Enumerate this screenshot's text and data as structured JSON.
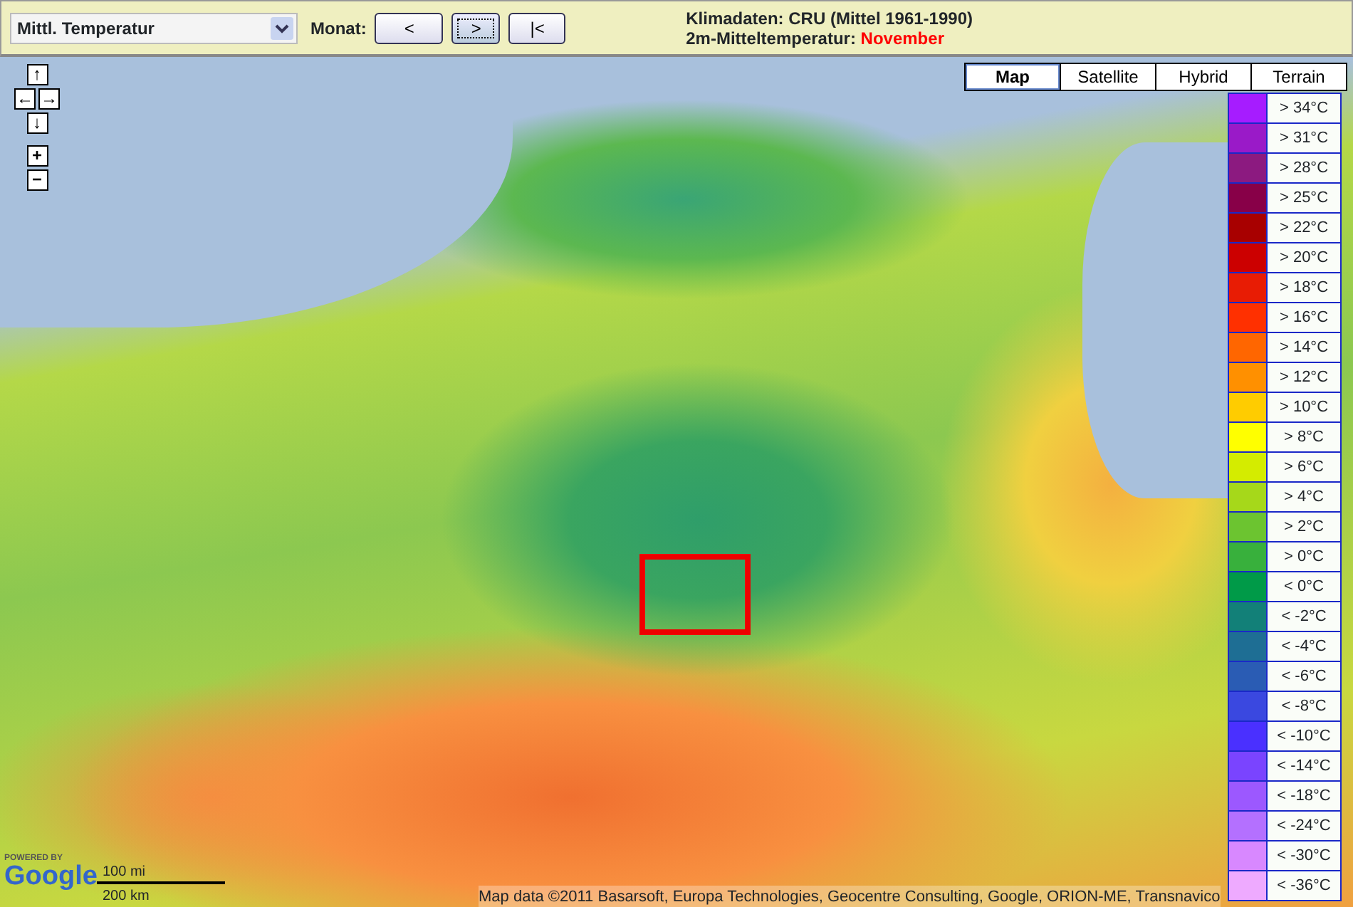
{
  "toolbar": {
    "layer_select": {
      "value": "Mittl. Temperatur"
    },
    "month_label": "Monat:",
    "month_buttons": [
      {
        "label": "<",
        "selected": false
      },
      {
        "label": ">",
        "selected": true
      },
      {
        "label": "|<",
        "selected": false
      }
    ],
    "info": {
      "line_1": "Klimadaten: CRU (Mittel 1961-1990)",
      "line_2_label": "2m-Mitteltemperatur:",
      "line_2_value": "November"
    }
  },
  "map": {
    "nav_rows": [
      {
        "kind": "pan",
        "keys": [
          "↑"
        ]
      },
      {
        "kind": "pan",
        "keys": [
          "←",
          "→"
        ]
      },
      {
        "kind": "pan",
        "keys": [
          "↓"
        ]
      },
      {
        "kind": "zoom",
        "keys": [
          "+"
        ]
      },
      {
        "kind": "zoom",
        "keys": [
          "−"
        ]
      }
    ],
    "map_types": [
      {
        "label": "Map",
        "selected": true
      },
      {
        "label": "Satellite",
        "selected": false
      },
      {
        "label": "Hybrid",
        "selected": false
      },
      {
        "label": "Terrain",
        "selected": false
      }
    ],
    "legend": [
      {
        "color": "#a61cff",
        "label": "> 34°C"
      },
      {
        "color": "#9a1ac8",
        "label": "> 31°C"
      },
      {
        "color": "#8c1a80",
        "label": "> 28°C"
      },
      {
        "color": "#880048",
        "label": "> 25°C"
      },
      {
        "color": "#a80000",
        "label": "> 22°C"
      },
      {
        "color": "#cc0000",
        "label": "> 20°C"
      },
      {
        "color": "#e81c04",
        "label": "> 18°C"
      },
      {
        "color": "#ff3000",
        "label": "> 16°C"
      },
      {
        "color": "#ff6600",
        "label": "> 14°C"
      },
      {
        "color": "#ff9000",
        "label": "> 12°C"
      },
      {
        "color": "#ffcc00",
        "label": "> 10°C"
      },
      {
        "color": "#ffff00",
        "label": "> 8°C"
      },
      {
        "color": "#d4ec00",
        "label": "> 6°C"
      },
      {
        "color": "#a6d81a",
        "label": "> 4°C"
      },
      {
        "color": "#6cc430",
        "label": "> 2°C"
      },
      {
        "color": "#38b03c",
        "label": "> 0°C"
      },
      {
        "color": "#009a48",
        "label": "< 0°C"
      },
      {
        "color": "#128078",
        "label": "< -2°C"
      },
      {
        "color": "#1e6e94",
        "label": "< -4°C"
      },
      {
        "color": "#2a5cb4",
        "label": "< -6°C"
      },
      {
        "color": "#3a48e0",
        "label": "< -8°C"
      },
      {
        "color": "#4a30ff",
        "label": "< -10°C"
      },
      {
        "color": "#7a44ff",
        "label": "< -14°C"
      },
      {
        "color": "#9c58ff",
        "label": "< -18°C"
      },
      {
        "color": "#b470ff",
        "label": "< -24°C"
      },
      {
        "color": "#d888ff",
        "label": "< -30°C"
      },
      {
        "color": "#eeaaff",
        "label": "< -36°C"
      }
    ],
    "logo": {
      "caption": "POWERED BY",
      "name": "Google"
    },
    "scale": {
      "miles": "100 mi",
      "km": "200 km"
    },
    "attribution": "Map data ©2011 Basarsoft, Europa Technologies, Geocentre Consulting, Google, ORION-ME, Transnavico"
  }
}
